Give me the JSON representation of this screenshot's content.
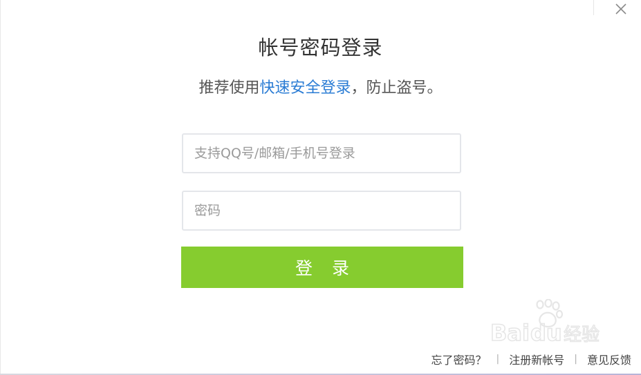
{
  "dialog": {
    "title": "帐号密码登录",
    "subtitle_prefix": "推荐使用",
    "subtitle_link": "快速安全登录",
    "subtitle_suffix": "，防止盗号。",
    "close_icon": "close-icon"
  },
  "form": {
    "account_placeholder": "支持QQ号/邮箱/手机号登录",
    "account_value": "",
    "password_placeholder": "密码",
    "password_value": "",
    "login_label": "登 录",
    "login_color": "#86cc2f"
  },
  "footer": {
    "forgot_password": "忘了密码？",
    "register": "注册新帐号",
    "feedback": "意见反馈",
    "separator": "|"
  },
  "watermark": {
    "text": "Baidu经验"
  },
  "colors": {
    "link": "#2a7cd4",
    "title": "#333333",
    "subtitle": "#555555"
  }
}
